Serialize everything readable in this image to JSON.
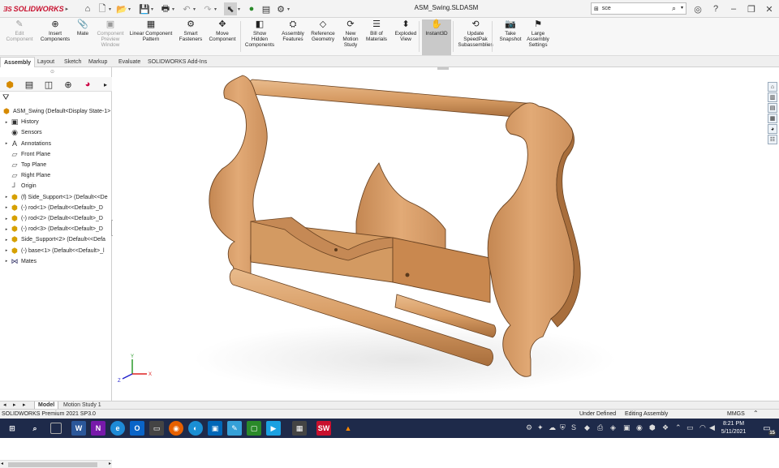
{
  "app": {
    "brand_letters": "ƎS",
    "brand": "SOLIDWORKS",
    "document_title": "ASM_Swing.SLDASM",
    "search": {
      "value": "sce"
    }
  },
  "quick_access": [
    "home-icon",
    "new-icon",
    "open-icon",
    "save-icon",
    "print-icon",
    "undo-icon",
    "redo-icon",
    "select-icon",
    "rebuild-icon",
    "file-properties-icon",
    "options-icon"
  ],
  "commands": [
    {
      "id": "edit-component",
      "label": "Edit\nComponent",
      "disabled": true,
      "icon": "✎"
    },
    {
      "id": "insert-components",
      "label": "Insert\nComponents",
      "disabled": false,
      "icon": "⊕"
    },
    {
      "id": "mate",
      "label": "Mate",
      "disabled": false,
      "icon": "📎"
    },
    {
      "id": "component-preview",
      "label": "Component\nPreview\nWindow",
      "disabled": true,
      "icon": "▣"
    },
    {
      "id": "linear-pattern",
      "label": "Linear Component\nPattern",
      "disabled": false,
      "icon": "▦"
    },
    {
      "id": "smart-fasteners",
      "label": "Smart\nFasteners",
      "disabled": false,
      "icon": "⚙"
    },
    {
      "id": "move-component",
      "label": "Move\nComponent",
      "disabled": false,
      "icon": "✥"
    },
    {
      "id": "show-hidden",
      "label": "Show\nHidden\nComponents",
      "disabled": false,
      "icon": "◧"
    },
    {
      "id": "assembly-features",
      "label": "Assembly\nFeatures",
      "disabled": false,
      "icon": "⛭"
    },
    {
      "id": "reference-geometry",
      "label": "Reference\nGeometry",
      "disabled": false,
      "icon": "◇"
    },
    {
      "id": "new-motion-study",
      "label": "New\nMotion\nStudy",
      "disabled": false,
      "icon": "⟳"
    },
    {
      "id": "bill-of-materials",
      "label": "Bill of\nMaterials",
      "disabled": false,
      "icon": "☰"
    },
    {
      "id": "exploded-view",
      "label": "Exploded\nView",
      "disabled": false,
      "icon": "⬍"
    },
    {
      "id": "instant3d",
      "label": "Instant3D",
      "disabled": false,
      "icon": "✋"
    },
    {
      "id": "update-speedpak",
      "label": "Update\nSpeedPak\nSubassemblies",
      "disabled": false,
      "icon": "⟲"
    },
    {
      "id": "take-snapshot",
      "label": "Take\nSnapshot",
      "disabled": false,
      "icon": "📷"
    },
    {
      "id": "large-assembly",
      "label": "Large\nAssembly\nSettings",
      "disabled": false,
      "icon": "⚑"
    }
  ],
  "tabs": [
    "Assembly",
    "Layout",
    "Sketch",
    "Markup",
    "Evaluate",
    "SOLIDWORKS Add-Ins"
  ],
  "active_tab": "Assembly",
  "tree": [
    {
      "label": "ASM_Swing  (Default<Display State-1>",
      "icon": "asm",
      "exp": ""
    },
    {
      "label": "History",
      "icon": "folder",
      "exp": "▸"
    },
    {
      "label": "Sensors",
      "icon": "sensor",
      "exp": ""
    },
    {
      "label": "Annotations",
      "icon": "annot",
      "exp": "▸"
    },
    {
      "label": "Front Plane",
      "icon": "plane",
      "exp": ""
    },
    {
      "label": "Top Plane",
      "icon": "plane",
      "exp": ""
    },
    {
      "label": "Right Plane",
      "icon": "plane",
      "exp": ""
    },
    {
      "label": "Origin",
      "icon": "origin",
      "exp": ""
    },
    {
      "label": "(f) Side_Support<1> (Default<<De",
      "icon": "part",
      "exp": "▸"
    },
    {
      "label": "(-) rod<1> (Default<<Default>_D",
      "icon": "part",
      "exp": "▸"
    },
    {
      "label": "(-) rod<2> (Default<<Default>_D",
      "icon": "part",
      "exp": "▸"
    },
    {
      "label": "(-) rod<3> (Default<<Default>_D",
      "icon": "part",
      "exp": "▸"
    },
    {
      "label": "Side_Support<2> (Default<<Defa",
      "icon": "part",
      "exp": "▸"
    },
    {
      "label": "(-) base<1> (Default<<Default>_l",
      "icon": "part",
      "exp": "▸"
    },
    {
      "label": "Mates",
      "icon": "mates",
      "exp": "▸"
    }
  ],
  "bottom_tabs": [
    "Model",
    "Motion Study 1"
  ],
  "status": {
    "left": "SOLIDWORKS Premium 2021 SP3.0",
    "state": "Under Defined",
    "mode": "Editing Assembly",
    "units": "MMGS"
  },
  "clock": {
    "time": "8:21 PM",
    "date": "5/11/2021"
  },
  "notifications": "15",
  "colors": {
    "wood": "#d9a06a",
    "wood_dark": "#b97a45",
    "accent": "#c8102e",
    "taskbar": "#1e2a4a"
  }
}
